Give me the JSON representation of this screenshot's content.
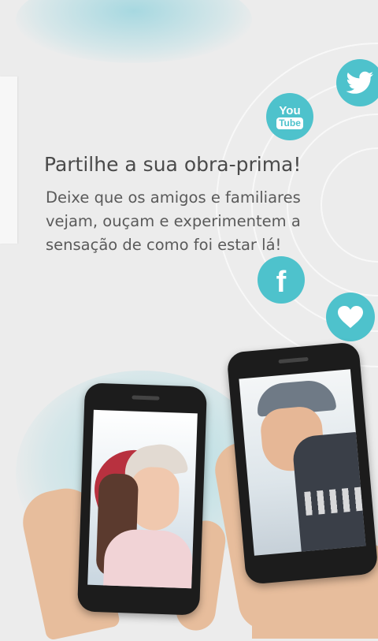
{
  "onboarding": {
    "heading": "Partilhe a sua obra-prima!",
    "body": "Deixe que os amigos e familiares vejam, ouçam e experimentem a sensação de como foi estar lá!"
  },
  "social_icons": {
    "youtube": {
      "icon": "youtube-icon",
      "label_top": "You",
      "label_bottom": "Tube"
    },
    "twitter": {
      "icon": "twitter-bird-icon"
    },
    "facebook": {
      "icon": "facebook-icon",
      "glyph": "f"
    },
    "heart": {
      "icon": "heart-icon"
    }
  },
  "colors": {
    "accent": "#4ec2cc",
    "background": "#ececec",
    "heading_text": "#4a4a4a",
    "body_text": "#5a5a5a"
  }
}
